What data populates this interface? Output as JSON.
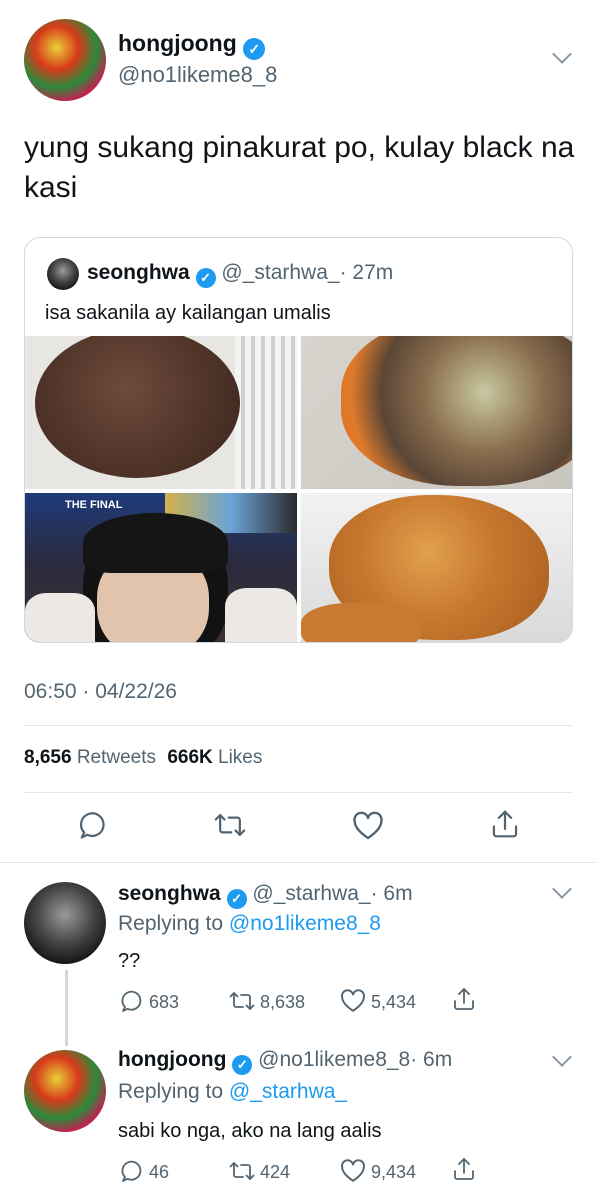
{
  "main_tweet": {
    "display_name": "hongjoong",
    "handle": "@no1likeme8_8",
    "text": "yung sukang pinakurat po, kulay black na kasi",
    "timestamp": "06:50 · 04/22/26",
    "retweets": "8,656",
    "retweets_label": "Retweets",
    "likes": "666K",
    "likes_label": "Likes"
  },
  "quoted_tweet": {
    "display_name": "seonghwa",
    "handle": "@_starhwa_",
    "time": "· 27m",
    "text": "isa sakanila ay kailangan umalis"
  },
  "replies": [
    {
      "display_name": "seonghwa",
      "handle": "@_starhwa_",
      "time": "· 6m",
      "replying_prefix": "Replying to",
      "replying_to": "@no1likeme8_8",
      "text": "??",
      "reply_count": "683",
      "retweet_count": "8,638",
      "like_count": "5,434"
    },
    {
      "display_name": "hongjoong",
      "handle": "@no1likeme8_8",
      "time": "· 6m",
      "replying_prefix": "Replying to",
      "replying_to": "@_starhwa_",
      "text": "sabi ko nga, ako na lang aalis",
      "reply_count": "46",
      "retweet_count": "424",
      "like_count": "9,434"
    }
  ],
  "media_overlay_text": "THE FINAL"
}
